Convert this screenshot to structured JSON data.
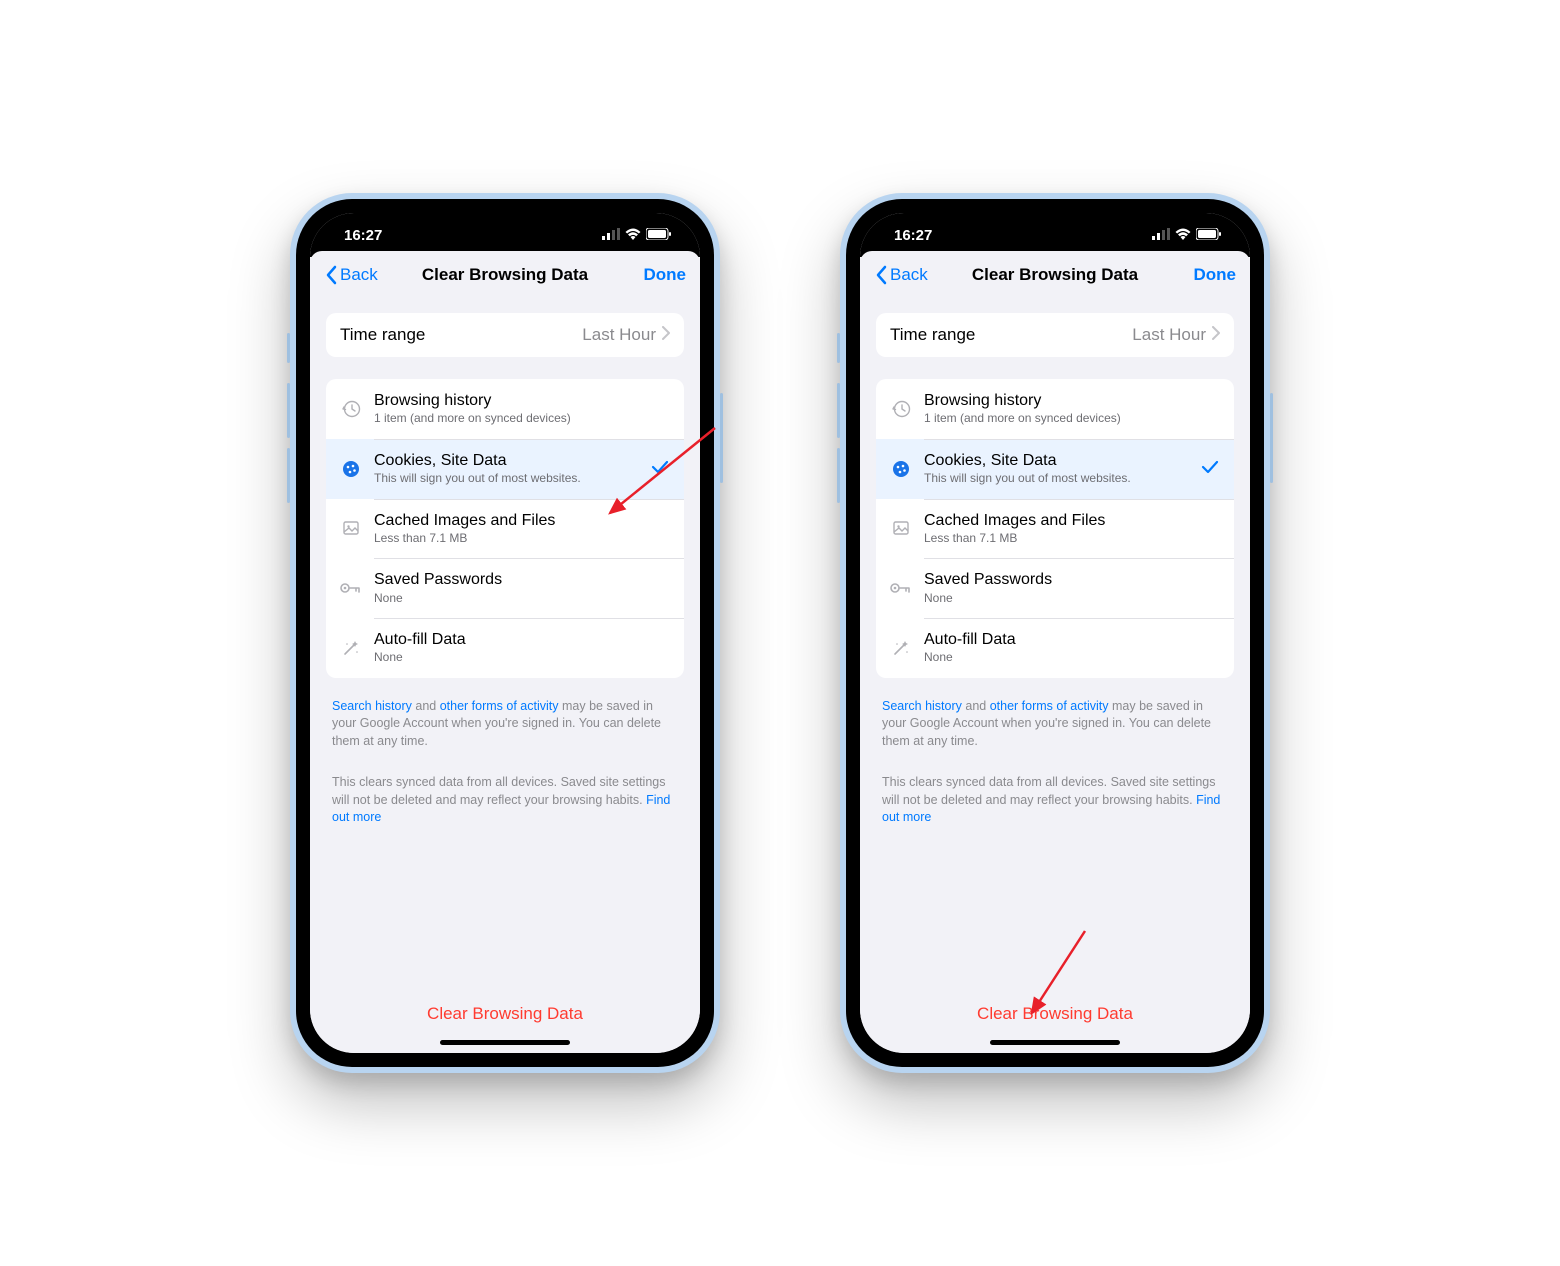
{
  "status": {
    "time": "16:27"
  },
  "nav": {
    "back": "Back",
    "title": "Clear Browsing Data",
    "done": "Done"
  },
  "timeRange": {
    "label": "Time range",
    "value": "Last Hour"
  },
  "items": [
    {
      "icon": "history-icon",
      "title": "Browsing history",
      "sub": "1 item (and more on synced devices)",
      "selected": false
    },
    {
      "icon": "cookie-icon",
      "title": "Cookies, Site Data",
      "sub": "This will sign you out of most websites.",
      "selected": true
    },
    {
      "icon": "image-icon",
      "title": "Cached Images and Files",
      "sub": "Less than 7.1 MB",
      "selected": false
    },
    {
      "icon": "key-icon",
      "title": "Saved Passwords",
      "sub": "None",
      "selected": false
    },
    {
      "icon": "wand-icon",
      "title": "Auto-fill Data",
      "sub": "None",
      "selected": false
    }
  ],
  "footer1": {
    "link1": "Search history",
    "mid1": " and ",
    "link2": "other forms of activity",
    "rest": " may be saved in your Google Account when you're signed in. You can delete them at any time."
  },
  "footer2": {
    "text": "This clears synced data from all devices. Saved site settings will not be deleted and may reflect your browsing habits. ",
    "link": "Find out more"
  },
  "clearButton": "Clear Browsing Data"
}
